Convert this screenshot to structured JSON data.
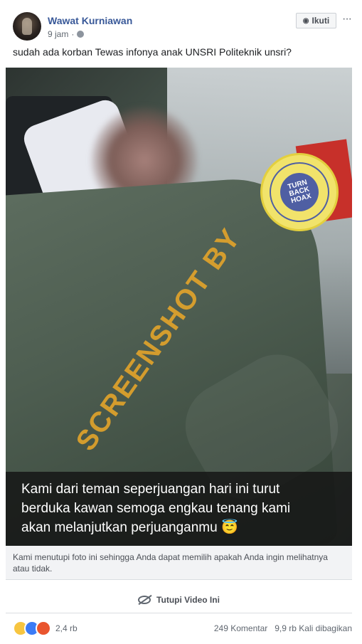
{
  "post": {
    "author": "Wawat Kurniawan",
    "time": "9 jam",
    "privacy_icon": "globe-icon",
    "follow_label": "Ikuti",
    "more_label": "···",
    "text": "sudah ada korban Tewas infonya anak UNSRI Politeknik unsri?"
  },
  "photo": {
    "watermark": "SCREENSHOT BY",
    "stamp_text": "TURN BACK HOAX",
    "caption_lines": [
      "Kami dari teman seperjuangan hari ini turut",
      "berduka kawan semoga engkau tenang kami",
      "akan melanjutkan perjuanganmu 😇"
    ]
  },
  "notice": "Kami menutupi foto ini sehingga Anda dapat memilih apakah Anda ingin melihatnya atau tidak.",
  "hide_label": "Tutupi Video Ini",
  "footer": {
    "reaction_count": "2,4 rb",
    "comments": "249 Komentar",
    "shares": "9,9 rb Kali dibagikan"
  },
  "colors": {
    "link": "#385898",
    "text": "#1c1e21",
    "meta": "#606770",
    "watermark": "#eca828"
  }
}
